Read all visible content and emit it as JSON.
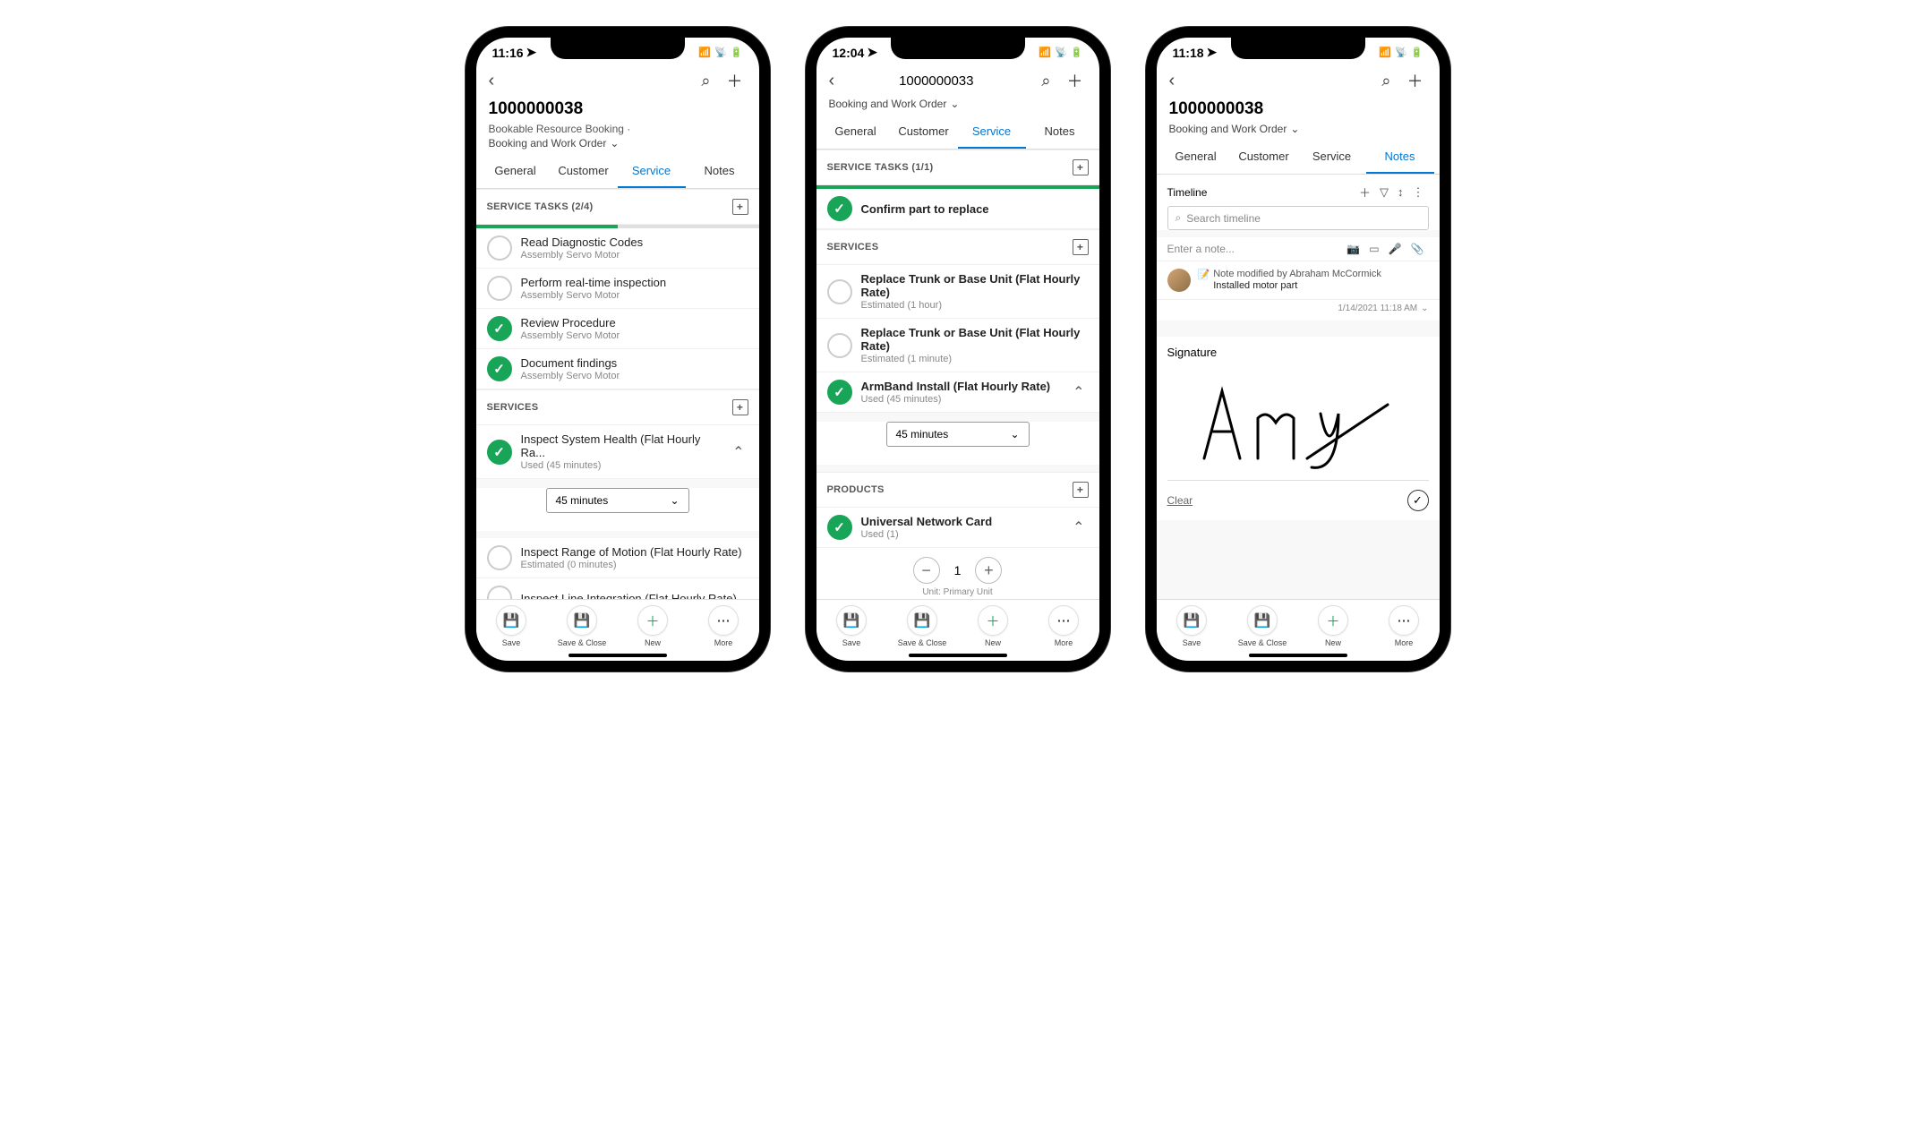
{
  "phone1": {
    "status_time": "11:16",
    "title": "1000000038",
    "subtitle": "Bookable Resource Booking  ·",
    "dropdown": "Booking and Work Order",
    "tabs": [
      "General",
      "Customer",
      "Service",
      "Notes"
    ],
    "active_tab": 2,
    "service_tasks_header": "SERVICE TASKS (2/4)",
    "progress_pct": 50,
    "tasks": [
      {
        "title": "Read Diagnostic Codes",
        "sub": "Assembly Servo Motor",
        "done": false
      },
      {
        "title": "Perform real-time inspection",
        "sub": "Assembly Servo Motor",
        "done": false
      },
      {
        "title": "Review Procedure",
        "sub": "Assembly Servo Motor",
        "done": true
      },
      {
        "title": "Document findings",
        "sub": "Assembly Servo Motor",
        "done": true
      }
    ],
    "services_header": "SERVICES",
    "services": [
      {
        "title": "Inspect System Health (Flat Hourly Ra...",
        "sub": "Used (45 minutes)",
        "done": true,
        "expanded": true,
        "dropdown_value": "45 minutes"
      },
      {
        "title": "Inspect Range of Motion (Flat Hourly Rate)",
        "sub": "Estimated (0 minutes)",
        "done": false
      },
      {
        "title": "Inspect Line Integration (Flat Hourly Rate)",
        "sub": "",
        "done": false
      }
    ]
  },
  "phone2": {
    "status_time": "12:04",
    "title": "1000000033",
    "dropdown": "Booking and Work Order",
    "tabs": [
      "General",
      "Customer",
      "Service",
      "Notes"
    ],
    "active_tab": 2,
    "service_tasks_header": "SERVICE TASKS (1/1)",
    "progress_pct": 100,
    "tasks": [
      {
        "title": "Confirm part to replace",
        "sub": "",
        "done": true
      }
    ],
    "services_header": "SERVICES",
    "services": [
      {
        "title": "Replace Trunk or Base Unit (Flat Hourly Rate)",
        "sub": "Estimated (1 hour)",
        "done": false
      },
      {
        "title": "Replace Trunk or Base Unit (Flat Hourly Rate)",
        "sub": "Estimated (1 minute)",
        "done": false
      },
      {
        "title": "ArmBand Install (Flat Hourly Rate)",
        "sub": "Used (45 minutes)",
        "done": true,
        "expanded": true,
        "dropdown_value": "45 minutes"
      }
    ],
    "products_header": "PRODUCTS",
    "products": [
      {
        "title": "Universal Network Card",
        "sub": "Used (1)",
        "done": true,
        "expanded": true,
        "qty": "1",
        "unit": "Unit: Primary Unit"
      }
    ]
  },
  "phone3": {
    "status_time": "11:18",
    "title": "1000000038",
    "dropdown": "Booking and Work Order",
    "tabs": [
      "General",
      "Customer",
      "Service",
      "Notes"
    ],
    "active_tab": 3,
    "timeline_label": "Timeline",
    "search_placeholder": "Search timeline",
    "note_placeholder": "Enter a note...",
    "note": {
      "header": "Note modified by Abraham McCormick",
      "body": "Installed motor part",
      "date": "1/14/2021 11:18 AM"
    },
    "signature_label": "Signature",
    "clear_label": "Clear"
  },
  "bottom": {
    "save": "Save",
    "save_close": "Save & Close",
    "new": "New",
    "more": "More"
  }
}
